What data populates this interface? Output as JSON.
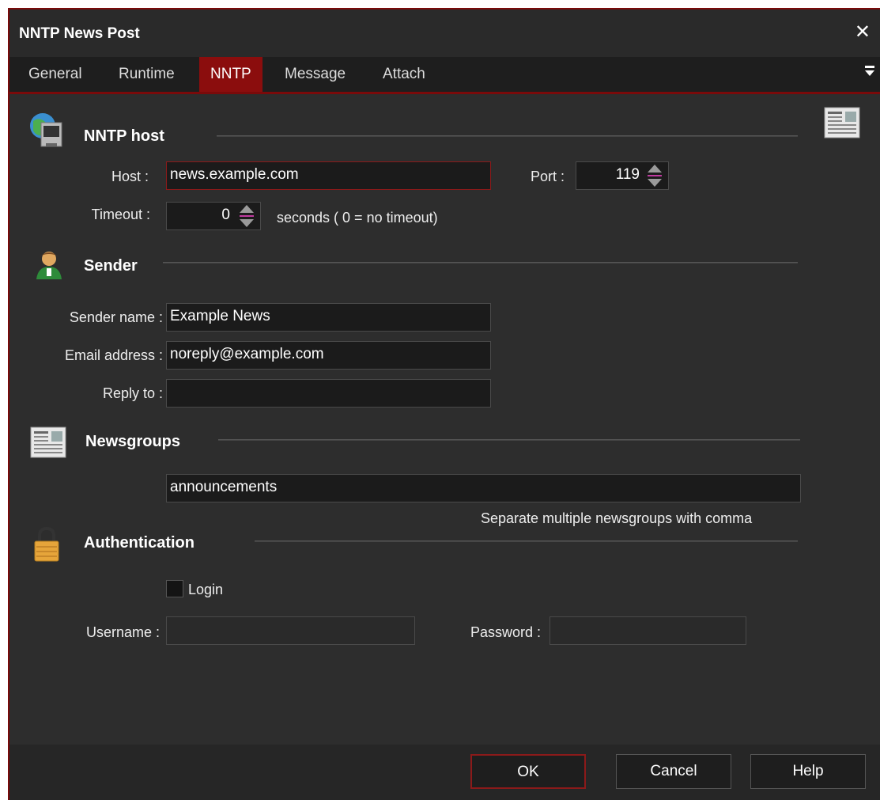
{
  "window": {
    "title": "NNTP News Post",
    "close_glyph": "✕"
  },
  "tabs": [
    {
      "label": "General"
    },
    {
      "label": "Runtime"
    },
    {
      "label": "NNTP"
    },
    {
      "label": "Message"
    },
    {
      "label": "Attach"
    }
  ],
  "active_tab": "NNTP",
  "nntp_host": {
    "title": "NNTP host",
    "host_label": "Host :",
    "host_value": "news.example.com",
    "port_label": "Port :",
    "port_value": "119",
    "timeout_label": "Timeout :",
    "timeout_value": "0",
    "timeout_hint": "seconds ( 0 = no timeout)"
  },
  "sender": {
    "title": "Sender",
    "name_label": "Sender name :",
    "name_value": "Example News",
    "email_label": "Email address :",
    "email_value": "noreply@example.com",
    "reply_label": "Reply to :",
    "reply_value": ""
  },
  "newsgroups": {
    "title": "Newsgroups",
    "value": "announcements",
    "hint": "Separate multiple newsgroups with comma"
  },
  "authentication": {
    "title": "Authentication",
    "login_label": "Login",
    "login_checked": false,
    "username_label": "Username :",
    "username_value": "",
    "password_label": "Password :",
    "password_value": ""
  },
  "buttons": {
    "ok": "OK",
    "cancel": "Cancel",
    "help": "Help"
  },
  "colors": {
    "accent": "#8b0d0d",
    "background": "#2d2d2d",
    "input_bg": "#1b1b1b"
  }
}
